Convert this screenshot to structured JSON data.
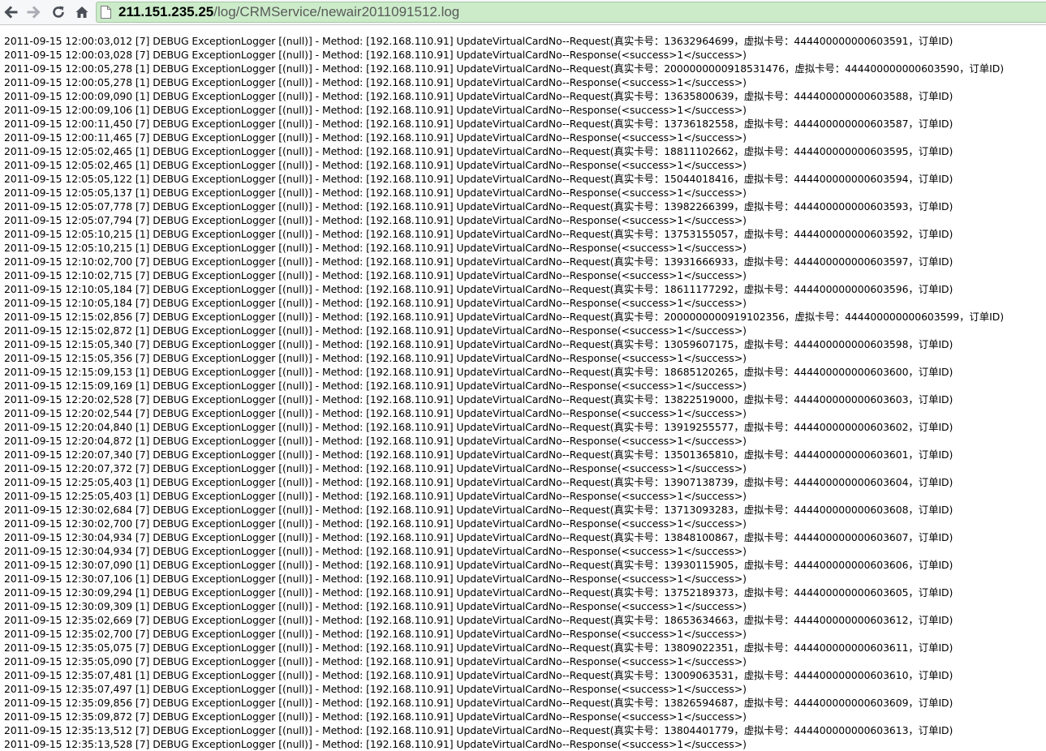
{
  "browser": {
    "url_host": "211.151.235.25",
    "url_path": "/log/CRMService/newair2011091512.log",
    "omnibox_color": "#cbebc9"
  },
  "log_lines": [
    "2011-09-15 12:00:03,012 [7] DEBUG ExceptionLogger [(null)] - Method: [192.168.110.91] UpdateVirtualCardNo--Request(真实卡号：13632964699，虚拟卡号：444400000000603591，订单ID)",
    "2011-09-15 12:00:03,028 [7] DEBUG ExceptionLogger [(null)] - Method: [192.168.110.91] UpdateVirtualCardNo--Response(<success>1</success>)",
    "2011-09-15 12:00:05,278 [1] DEBUG ExceptionLogger [(null)] - Method: [192.168.110.91] UpdateVirtualCardNo--Request(真实卡号：2000000000918531476，虚拟卡号：444400000000603590，订单ID)",
    "2011-09-15 12:00:05,278 [1] DEBUG ExceptionLogger [(null)] - Method: [192.168.110.91] UpdateVirtualCardNo--Response(<success>1</success>)",
    "2011-09-15 12:00:09,090 [1] DEBUG ExceptionLogger [(null)] - Method: [192.168.110.91] UpdateVirtualCardNo--Request(真实卡号：13635800639，虚拟卡号：444400000000603588，订单ID)",
    "2011-09-15 12:00:09,106 [1] DEBUG ExceptionLogger [(null)] - Method: [192.168.110.91] UpdateVirtualCardNo--Response(<success>1</success>)",
    "2011-09-15 12:00:11,450 [7] DEBUG ExceptionLogger [(null)] - Method: [192.168.110.91] UpdateVirtualCardNo--Request(真实卡号：13736182558，虚拟卡号：444400000000603587，订单ID)",
    "2011-09-15 12:00:11,465 [7] DEBUG ExceptionLogger [(null)] - Method: [192.168.110.91] UpdateVirtualCardNo--Response(<success>1</success>)",
    "2011-09-15 12:05:02,465 [1] DEBUG ExceptionLogger [(null)] - Method: [192.168.110.91] UpdateVirtualCardNo--Request(真实卡号：18811102662，虚拟卡号：444400000000603595，订单ID)",
    "2011-09-15 12:05:02,465 [1] DEBUG ExceptionLogger [(null)] - Method: [192.168.110.91] UpdateVirtualCardNo--Response(<success>1</success>)",
    "2011-09-15 12:05:05,122 [1] DEBUG ExceptionLogger [(null)] - Method: [192.168.110.91] UpdateVirtualCardNo--Request(真实卡号：15044018416，虚拟卡号：444400000000603594，订单ID)",
    "2011-09-15 12:05:05,137 [1] DEBUG ExceptionLogger [(null)] - Method: [192.168.110.91] UpdateVirtualCardNo--Response(<success>1</success>)",
    "2011-09-15 12:05:07,778 [7] DEBUG ExceptionLogger [(null)] - Method: [192.168.110.91] UpdateVirtualCardNo--Request(真实卡号：13982266399，虚拟卡号：444400000000603593，订单ID)",
    "2011-09-15 12:05:07,794 [7] DEBUG ExceptionLogger [(null)] - Method: [192.168.110.91] UpdateVirtualCardNo--Response(<success>1</success>)",
    "2011-09-15 12:05:10,215 [1] DEBUG ExceptionLogger [(null)] - Method: [192.168.110.91] UpdateVirtualCardNo--Request(真实卡号：13753155057，虚拟卡号：444400000000603592，订单ID)",
    "2011-09-15 12:05:10,215 [1] DEBUG ExceptionLogger [(null)] - Method: [192.168.110.91] UpdateVirtualCardNo--Response(<success>1</success>)",
    "2011-09-15 12:10:02,700 [7] DEBUG ExceptionLogger [(null)] - Method: [192.168.110.91] UpdateVirtualCardNo--Request(真实卡号：13931666933，虚拟卡号：444400000000603597，订单ID)",
    "2011-09-15 12:10:02,715 [7] DEBUG ExceptionLogger [(null)] - Method: [192.168.110.91] UpdateVirtualCardNo--Response(<success>1</success>)",
    "2011-09-15 12:10:05,184 [7] DEBUG ExceptionLogger [(null)] - Method: [192.168.110.91] UpdateVirtualCardNo--Request(真实卡号：18611177292，虚拟卡号：444400000000603596，订单ID)",
    "2011-09-15 12:10:05,184 [7] DEBUG ExceptionLogger [(null)] - Method: [192.168.110.91] UpdateVirtualCardNo--Response(<success>1</success>)",
    "2011-09-15 12:15:02,856 [7] DEBUG ExceptionLogger [(null)] - Method: [192.168.110.91] UpdateVirtualCardNo--Request(真实卡号：2000000000919102356，虚拟卡号：444400000000603599，订单ID)",
    "2011-09-15 12:15:02,872 [1] DEBUG ExceptionLogger [(null)] - Method: [192.168.110.91] UpdateVirtualCardNo--Response(<success>1</success>)",
    "2011-09-15 12:15:05,340 [7] DEBUG ExceptionLogger [(null)] - Method: [192.168.110.91] UpdateVirtualCardNo--Request(真实卡号：13059607175，虚拟卡号：444400000000603598，订单ID)",
    "2011-09-15 12:15:05,356 [7] DEBUG ExceptionLogger [(null)] - Method: [192.168.110.91] UpdateVirtualCardNo--Response(<success>1</success>)",
    "2011-09-15 12:15:09,153 [1] DEBUG ExceptionLogger [(null)] - Method: [192.168.110.91] UpdateVirtualCardNo--Request(真实卡号：18685120265，虚拟卡号：444400000000603600，订单ID)",
    "2011-09-15 12:15:09,169 [1] DEBUG ExceptionLogger [(null)] - Method: [192.168.110.91] UpdateVirtualCardNo--Response(<success>1</success>)",
    "2011-09-15 12:20:02,528 [7] DEBUG ExceptionLogger [(null)] - Method: [192.168.110.91] UpdateVirtualCardNo--Request(真实卡号：13822519000，虚拟卡号：444400000000603603，订单ID)",
    "2011-09-15 12:20:02,544 [7] DEBUG ExceptionLogger [(null)] - Method: [192.168.110.91] UpdateVirtualCardNo--Response(<success>1</success>)",
    "2011-09-15 12:20:04,840 [1] DEBUG ExceptionLogger [(null)] - Method: [192.168.110.91] UpdateVirtualCardNo--Request(真实卡号：13919255577，虚拟卡号：444400000000603602，订单ID)",
    "2011-09-15 12:20:04,872 [1] DEBUG ExceptionLogger [(null)] - Method: [192.168.110.91] UpdateVirtualCardNo--Response(<success>1</success>)",
    "2011-09-15 12:20:07,340 [7] DEBUG ExceptionLogger [(null)] - Method: [192.168.110.91] UpdateVirtualCardNo--Request(真实卡号：13501365810，虚拟卡号：444400000000603601，订单ID)",
    "2011-09-15 12:20:07,372 [7] DEBUG ExceptionLogger [(null)] - Method: [192.168.110.91] UpdateVirtualCardNo--Response(<success>1</success>)",
    "2011-09-15 12:25:05,403 [1] DEBUG ExceptionLogger [(null)] - Method: [192.168.110.91] UpdateVirtualCardNo--Request(真实卡号：13907138739，虚拟卡号：444400000000603604，订单ID)",
    "2011-09-15 12:25:05,403 [1] DEBUG ExceptionLogger [(null)] - Method: [192.168.110.91] UpdateVirtualCardNo--Response(<success>1</success>)",
    "2011-09-15 12:30:02,684 [7] DEBUG ExceptionLogger [(null)] - Method: [192.168.110.91] UpdateVirtualCardNo--Request(真实卡号：13713093283，虚拟卡号：444400000000603608，订单ID)",
    "2011-09-15 12:30:02,700 [7] DEBUG ExceptionLogger [(null)] - Method: [192.168.110.91] UpdateVirtualCardNo--Response(<success>1</success>)",
    "2011-09-15 12:30:04,934 [7] DEBUG ExceptionLogger [(null)] - Method: [192.168.110.91] UpdateVirtualCardNo--Request(真实卡号：13848100867，虚拟卡号：444400000000603607，订单ID)",
    "2011-09-15 12:30:04,934 [7] DEBUG ExceptionLogger [(null)] - Method: [192.168.110.91] UpdateVirtualCardNo--Response(<success>1</success>)",
    "2011-09-15 12:30:07,090 [1] DEBUG ExceptionLogger [(null)] - Method: [192.168.110.91] UpdateVirtualCardNo--Request(真实卡号：13930115905，虚拟卡号：444400000000603606，订单ID)",
    "2011-09-15 12:30:07,106 [1] DEBUG ExceptionLogger [(null)] - Method: [192.168.110.91] UpdateVirtualCardNo--Response(<success>1</success>)",
    "2011-09-15 12:30:09,294 [1] DEBUG ExceptionLogger [(null)] - Method: [192.168.110.91] UpdateVirtualCardNo--Request(真实卡号：13752189373，虚拟卡号：444400000000603605，订单ID)",
    "2011-09-15 12:30:09,309 [1] DEBUG ExceptionLogger [(null)] - Method: [192.168.110.91] UpdateVirtualCardNo--Response(<success>1</success>)",
    "2011-09-15 12:35:02,669 [7] DEBUG ExceptionLogger [(null)] - Method: [192.168.110.91] UpdateVirtualCardNo--Request(真实卡号：18653634663，虚拟卡号：444400000000603612，订单ID)",
    "2011-09-15 12:35:02,700 [7] DEBUG ExceptionLogger [(null)] - Method: [192.168.110.91] UpdateVirtualCardNo--Response(<success>1</success>)",
    "2011-09-15 12:35:05,075 [7] DEBUG ExceptionLogger [(null)] - Method: [192.168.110.91] UpdateVirtualCardNo--Request(真实卡号：13809022351，虚拟卡号：444400000000603611，订单ID)",
    "2011-09-15 12:35:05,090 [7] DEBUG ExceptionLogger [(null)] - Method: [192.168.110.91] UpdateVirtualCardNo--Response(<success>1</success>)",
    "2011-09-15 12:35:07,481 [1] DEBUG ExceptionLogger [(null)] - Method: [192.168.110.91] UpdateVirtualCardNo--Request(真实卡号：13009063531，虚拟卡号：444400000000603610，订单ID)",
    "2011-09-15 12:35:07,497 [1] DEBUG ExceptionLogger [(null)] - Method: [192.168.110.91] UpdateVirtualCardNo--Response(<success>1</success>)",
    "2011-09-15 12:35:09,856 [7] DEBUG ExceptionLogger [(null)] - Method: [192.168.110.91] UpdateVirtualCardNo--Request(真实卡号：13826594687，虚拟卡号：444400000000603609，订单ID)",
    "2011-09-15 12:35:09,872 [7] DEBUG ExceptionLogger [(null)] - Method: [192.168.110.91] UpdateVirtualCardNo--Response(<success>1</success>)",
    "2011-09-15 12:35:13,512 [7] DEBUG ExceptionLogger [(null)] - Method: [192.168.110.91] UpdateVirtualCardNo--Request(真实卡号：13804401779，虚拟卡号：444400000000603613，订单ID)",
    "2011-09-15 12:35:13,528 [7] DEBUG ExceptionLogger [(null)] - Method: [192.168.110.91] UpdateVirtualCardNo--Response(<success>1</success>)"
  ]
}
